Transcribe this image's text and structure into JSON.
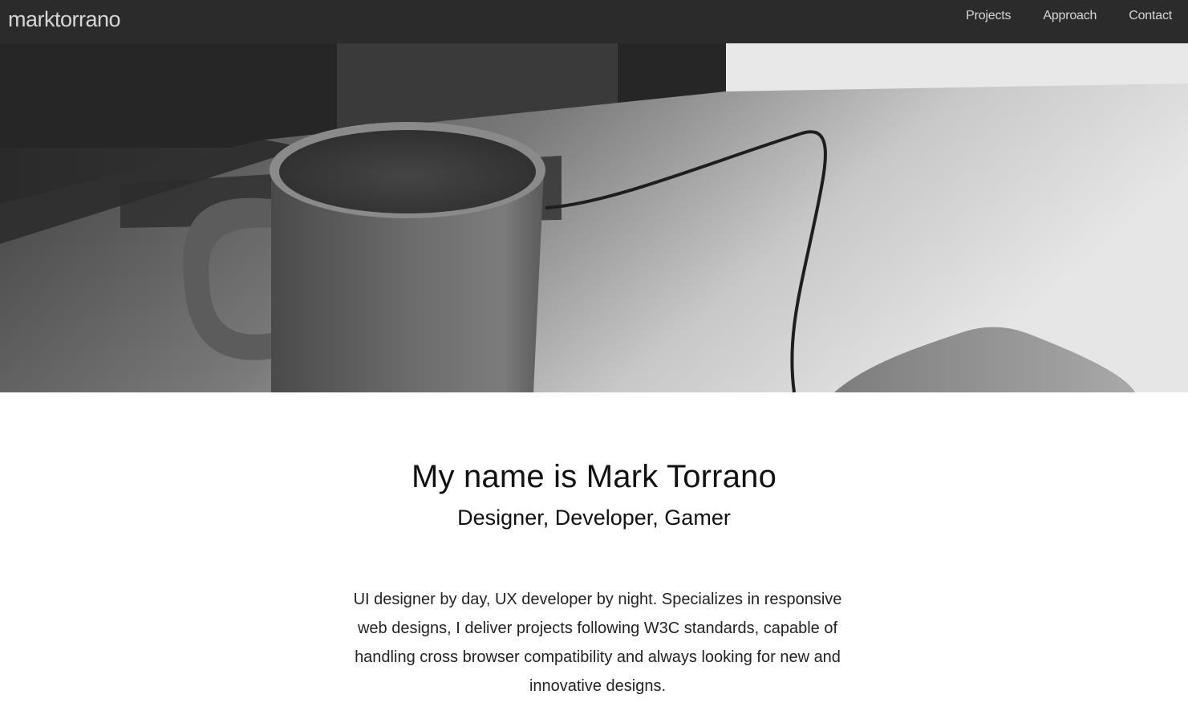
{
  "navbar": {
    "brand": "marktorrano",
    "links": [
      {
        "label": "Projects"
      },
      {
        "label": "Approach"
      },
      {
        "label": "Contact"
      }
    ]
  },
  "hero": {
    "image": "coffee-mug-cable-hand-grayscale-photo"
  },
  "intro": {
    "title": "My name is Mark Torrano",
    "subtitle": "Designer, Developer, Gamer",
    "bio": "UI designer by day, UX developer by night. Specializes in responsive web designs, I deliver projects following W3C standards, capable of handling cross browser compatibility and always looking for new and innovative designs."
  },
  "colors": {
    "navbar_bg": "#2b2b2b",
    "nav_text": "#d6d6d6",
    "body_text": "#111111"
  }
}
